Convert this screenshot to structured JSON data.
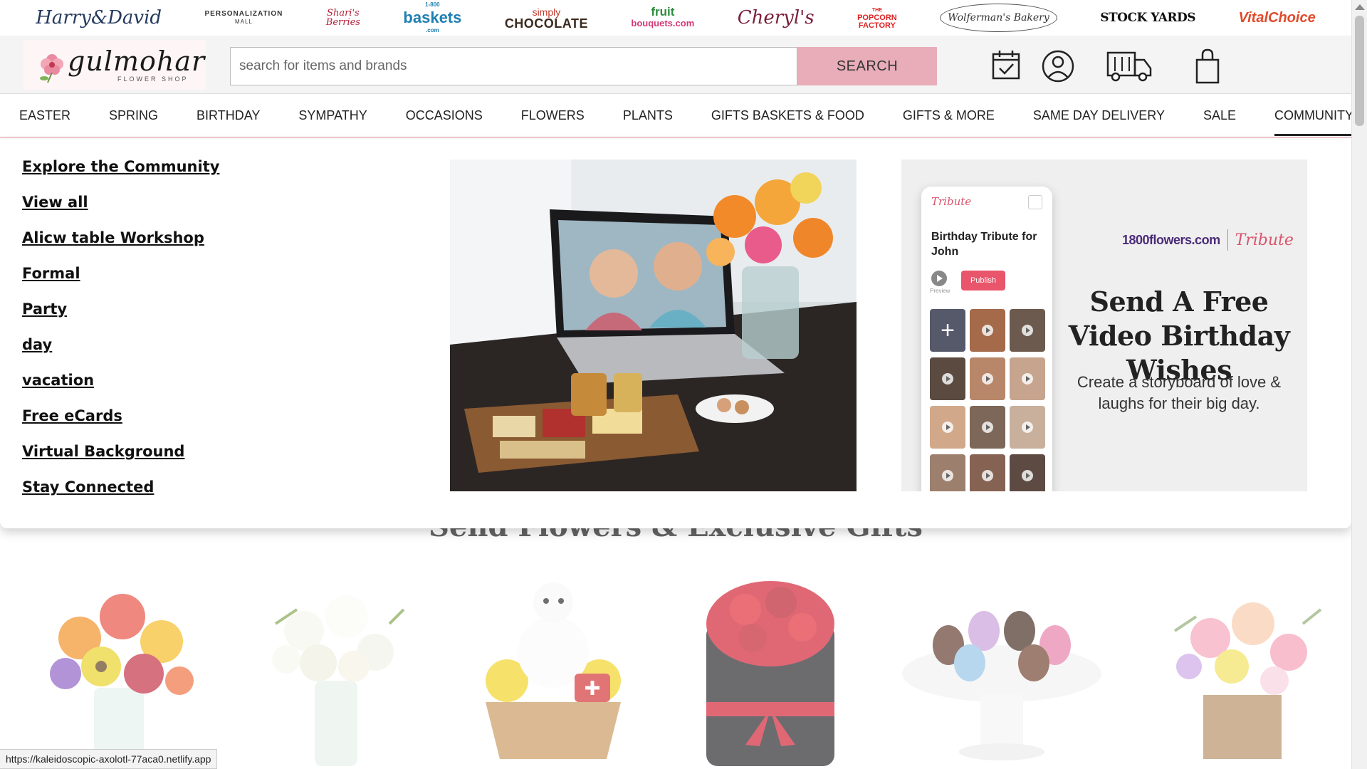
{
  "brands": [
    {
      "id": "harry-david",
      "text": "Harry&David"
    },
    {
      "id": "personalization-mall",
      "line1": "PERSONALIZATION",
      "line2": "MALL"
    },
    {
      "id": "sharis-berries",
      "line1": "Shari's",
      "line2": "Berries"
    },
    {
      "id": "1800-baskets",
      "small": "1-800",
      "main": "baskets",
      "suffix": ".com"
    },
    {
      "id": "simply-chocolate",
      "line1": "simply",
      "line2": "CHOCOLATE"
    },
    {
      "id": "fruit-bouquets",
      "line1": "fruit",
      "line2": "bouquets.com"
    },
    {
      "id": "cheryls",
      "text": "Cheryl's"
    },
    {
      "id": "popcorn-factory",
      "line1": "THE",
      "line2": "POPCORN",
      "line3": "FACTORY"
    },
    {
      "id": "wolfermans",
      "text": "Wolferman's Bakery"
    },
    {
      "id": "stock-yards",
      "text": "STOCK YARDS"
    },
    {
      "id": "vital-choice",
      "text": "VitalChoice"
    }
  ],
  "header": {
    "logo_text": "gulmohar",
    "logo_sub": "FLOWER SHOP",
    "search_placeholder": "search for items and brands",
    "search_button": "SEARCH",
    "icons": [
      "calendar-check-icon",
      "account-icon",
      "delivery-truck-icon",
      "shopping-bag-icon"
    ]
  },
  "nav": {
    "items": [
      "EASTER",
      "SPRING",
      "BIRTHDAY",
      "SYMPATHY",
      "OCCASIONS",
      "FLOWERS",
      "PLANTS",
      "GIFTS BASKETS & FOOD",
      "GIFTS & MORE",
      "SAME DAY DELIVERY",
      "SALE",
      "COMMUNITY"
    ],
    "active": "COMMUNITY"
  },
  "dropdown": {
    "links": [
      "Explore the Community",
      "View all",
      "Alicw table Workshop",
      "Formal",
      "Party",
      "day",
      "vacation",
      "Free eCards",
      "Virtual Background",
      "Stay Connected"
    ],
    "promo": {
      "phone_logo": "Tribute",
      "phone_title": "Birthday Tribute for John",
      "phone_preview": "Preview",
      "phone_publish": "Publish",
      "brand_1800": "1800flowers.com",
      "brand_tribute": "Tribute",
      "headline": "Send A Free Video Birthday Wishes",
      "subtext": "Create a storyboard of love & laughs for their big day."
    }
  },
  "page": {
    "section_title": "Send Flowers & Exclusive Gifts"
  },
  "status_bar": {
    "url": "https://kaleidoscopic-axolotl-77aca0.netlify.app"
  },
  "colors": {
    "search_button": "#e8adb9",
    "nav_underline": "#f0c7cf",
    "publish": "#e9556b",
    "tribute": "#d9546d"
  }
}
